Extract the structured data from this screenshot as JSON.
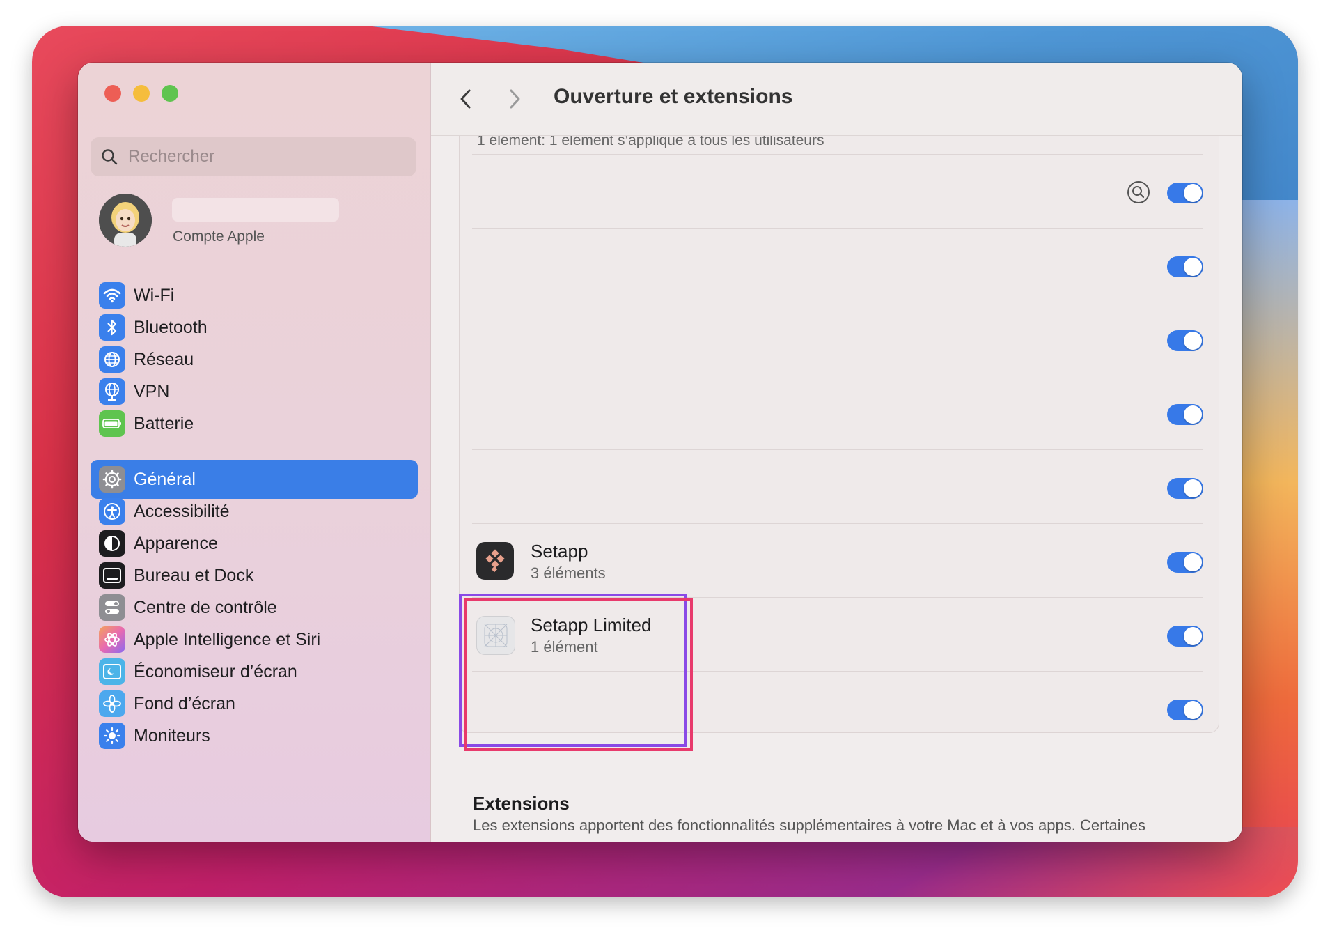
{
  "sidebar": {
    "search_placeholder": "Rechercher",
    "account_subtitle": "Compte Apple",
    "items": [
      {
        "label": "Wi-Fi",
        "icon": "wifi-icon",
        "color": "#3a80ec"
      },
      {
        "label": "Bluetooth",
        "icon": "bluetooth-icon",
        "color": "#3a80ec"
      },
      {
        "label": "Réseau",
        "icon": "globe-icon",
        "color": "#3a80ec"
      },
      {
        "label": "VPN",
        "icon": "vpn-globe-icon",
        "color": "#3a80ec"
      },
      {
        "label": "Batterie",
        "icon": "battery-icon",
        "color": "#5fc44f"
      },
      {
        "label": "Général",
        "icon": "gear-icon",
        "color": "#8e8e93",
        "active": true
      },
      {
        "label": "Accessibilité",
        "icon": "accessibility-icon",
        "color": "#3a80ec"
      },
      {
        "label": "Apparence",
        "icon": "appearance-icon",
        "color": "#1d1d1f"
      },
      {
        "label": "Bureau et Dock",
        "icon": "dock-icon",
        "color": "#1d1d1f"
      },
      {
        "label": "Centre de contrôle",
        "icon": "control-center-icon",
        "color": "#8e8e93"
      },
      {
        "label": "Apple Intelligence et Siri",
        "icon": "siri-icon",
        "color": "#e86ab0"
      },
      {
        "label": "Économiseur d’écran",
        "icon": "screensaver-icon",
        "color": "#4cb4e8"
      },
      {
        "label": "Fond d’écran",
        "icon": "wallpaper-icon",
        "color": "#4ca8ee"
      },
      {
        "label": "Moniteurs",
        "icon": "sun-icon",
        "color": "#3a80ec"
      }
    ]
  },
  "main": {
    "title": "Ouverture et extensions",
    "partial_row_text": "1 élément: 1 élément s’applique à tous les utilisateurs",
    "rows": [
      {
        "name": "",
        "sub": "",
        "toggle": true,
        "has_info": true
      },
      {
        "name": "",
        "sub": "",
        "toggle": true
      },
      {
        "name": "",
        "sub": "",
        "toggle": true
      },
      {
        "name": "",
        "sub": "",
        "toggle": true
      },
      {
        "name": "",
        "sub": "",
        "toggle": true
      },
      {
        "name": "Setapp",
        "sub": "3 éléments",
        "toggle": true,
        "icon": "setapp-icon"
      },
      {
        "name": "Setapp Limited",
        "sub": "1 élément",
        "toggle": true,
        "icon": "generic-app-icon"
      },
      {
        "name": "",
        "sub": "",
        "toggle": true
      }
    ],
    "extensions": {
      "title": "Extensions",
      "description": "Les extensions apportent des fonctionnalités supplémentaires à votre Mac et à vos apps. Certaines"
    }
  },
  "colors": {
    "accent": "#3a7ee7",
    "toggle_on": "#3779e8",
    "highlight_purple": "#8a4ae6",
    "highlight_pink": "#e83a6c"
  }
}
